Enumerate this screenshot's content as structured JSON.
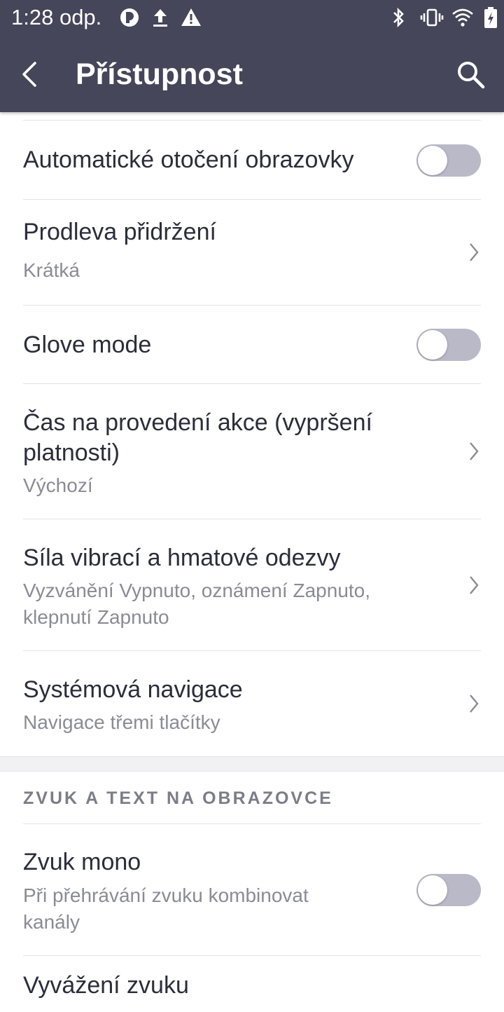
{
  "status_bar": {
    "time": "1:28 odp.",
    "left_icons": [
      "data-saver-icon",
      "upload-icon",
      "warning-icon"
    ],
    "right_icons": [
      "bluetooth-icon",
      "vibrate-icon",
      "wifi-icon",
      "battery-charging-icon"
    ]
  },
  "app_bar": {
    "title": "Přístupnost",
    "back_icon": "back-arrow-icon",
    "search_icon": "search-icon",
    "background": "#454659"
  },
  "items": [
    {
      "title": "Automatické otočení obrazovky",
      "control": "toggle",
      "on": false
    },
    {
      "title": "Prodleva přidržení",
      "subtitle": "Krátká",
      "control": "chevron"
    },
    {
      "title": "Glove mode",
      "control": "toggle",
      "on": false
    },
    {
      "title_line1": "Čas na provedení akce (vypršení",
      "title_line2": "platnosti)",
      "subtitle": "Výchozí",
      "control": "chevron"
    },
    {
      "title": "Síla vibrací a hmatové odezvy",
      "subtitle_line1": "Vyzvánění Vypnuto, oznámení Zapnuto,",
      "subtitle_line2": "klepnutí Zapnuto",
      "control": "chevron"
    },
    {
      "title": "Systémová navigace",
      "subtitle": "Navigace třemi tlačítky",
      "control": "chevron"
    }
  ],
  "section": {
    "header": "ZVUK A TEXT NA OBRAZOVCE",
    "items": [
      {
        "title": "Zvuk mono",
        "subtitle_line1": "Při přehrávání zvuku kombinovat",
        "subtitle_line2": "kanály",
        "control": "toggle",
        "on": false
      },
      {
        "title": "Vyvážení zvuku"
      }
    ]
  },
  "colors": {
    "toggle_off_track": "#b9b9c8",
    "divider": "#e3e3e7",
    "subtitle": "#8b8b96"
  }
}
